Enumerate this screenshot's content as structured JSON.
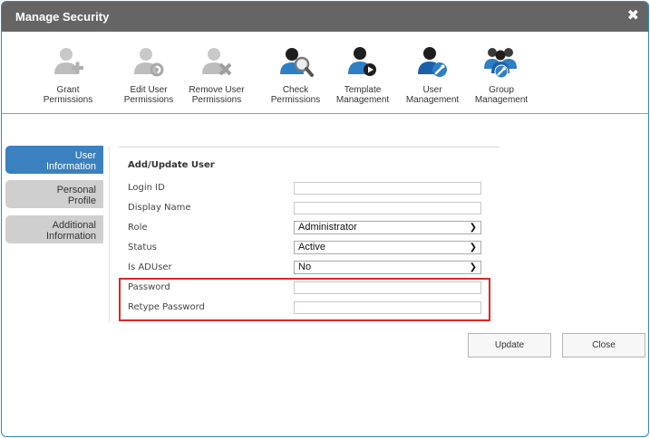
{
  "window": {
    "title": "Manage Security",
    "close_glyph": "✖"
  },
  "toolbar": [
    {
      "line1": "Grant",
      "line2": "Permissions",
      "icon": "user-add-icon"
    },
    {
      "line1": "Edit User",
      "line2": "Permissions",
      "icon": "user-edit-gear-icon"
    },
    {
      "line1": "Remove User",
      "line2": "Permissions",
      "icon": "user-remove-icon"
    },
    {
      "line1": "Check",
      "line2": "Permissions",
      "icon": "user-search-icon"
    },
    {
      "line1": "Template",
      "line2": "Management",
      "icon": "user-template-icon"
    },
    {
      "line1": "User",
      "line2": "Management",
      "icon": "user-wrench-icon"
    },
    {
      "line1": "Group",
      "line2": "Management",
      "icon": "group-wrench-icon"
    }
  ],
  "sidebar": [
    {
      "line1": "User",
      "line2": "Information",
      "active": true
    },
    {
      "line1": "Personal",
      "line2": "Profile",
      "active": false
    },
    {
      "line1": "Additional",
      "line2": "Information",
      "active": false
    }
  ],
  "form": {
    "title": "Add/Update User",
    "login_id": {
      "label": "Login ID",
      "value": ""
    },
    "display_name": {
      "label": "Display Name",
      "value": ""
    },
    "role": {
      "label": "Role",
      "value": "Administrator"
    },
    "status": {
      "label": "Status",
      "value": "Active"
    },
    "is_aduser": {
      "label": "Is ADUser",
      "value": "No"
    },
    "password": {
      "label": "Password",
      "value": ""
    },
    "retype_password": {
      "label": "Retype Password",
      "value": ""
    }
  },
  "buttons": {
    "update": "Update",
    "close": "Close"
  },
  "colors": {
    "titlebar": "#656565",
    "active_tab": "#3b80bf",
    "inactive_tab": "#cfcfcf",
    "highlight_box": "#e02525",
    "toolbar_divider": "#e87a7a"
  }
}
